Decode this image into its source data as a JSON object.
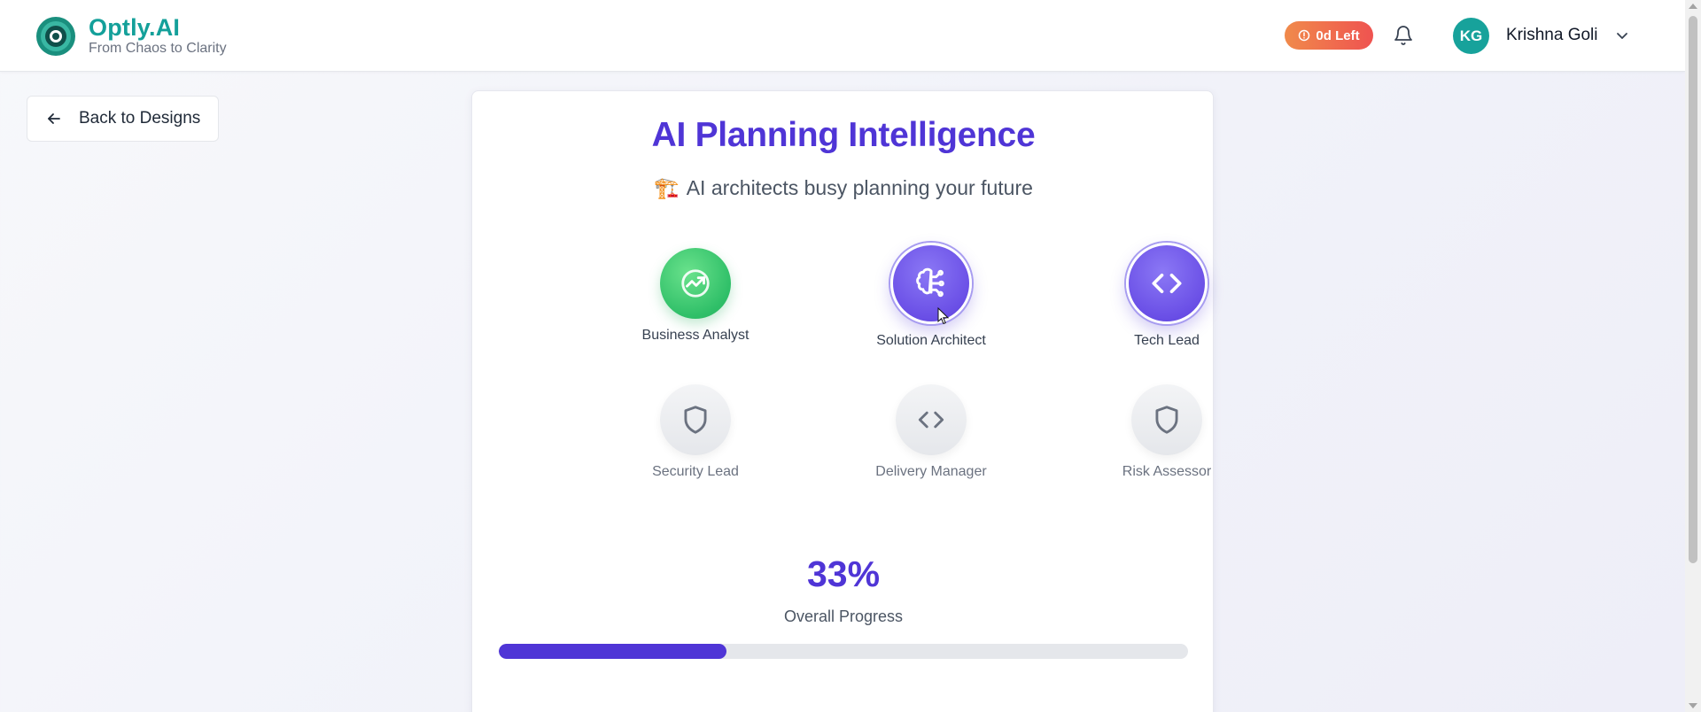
{
  "header": {
    "brand_name": "Optly.AI",
    "brand_tagline": "From Chaos to Clarity",
    "trial_badge": "0d Left",
    "user_initials": "KG",
    "user_name": "Krishna Goli",
    "icons": {
      "logo": "eye-logo",
      "trial": "clock-icon",
      "notifications": "bell-icon",
      "menu": "chevron-down-icon"
    }
  },
  "back_button": {
    "label": "Back to Designs",
    "icon": "arrow-left-icon"
  },
  "card": {
    "title": "AI Planning Intelligence",
    "subtitle_emoji": "🏗️",
    "subtitle": "AI architects busy planning your future"
  },
  "agents": [
    {
      "name": "Business Analyst",
      "status": "completed",
      "icon": "trending-up-icon"
    },
    {
      "name": "Solution Architect",
      "status": "active",
      "icon": "brain-icon"
    },
    {
      "name": "Tech Lead",
      "status": "active",
      "icon": "code-icon"
    },
    {
      "name": "Security Lead",
      "status": "pending",
      "icon": "shield-icon"
    },
    {
      "name": "Delivery Manager",
      "status": "pending",
      "icon": "code-icon"
    },
    {
      "name": "Risk Assessor",
      "status": "pending",
      "icon": "shield-icon"
    }
  ],
  "progress": {
    "percent_text": "33%",
    "label": "Overall Progress",
    "value": 0.33
  },
  "colors": {
    "brand_teal": "#14a09a",
    "accent_purple": "#4f35d6",
    "completed_green": "#2fbf68",
    "trial_orange": "#ef5350"
  }
}
